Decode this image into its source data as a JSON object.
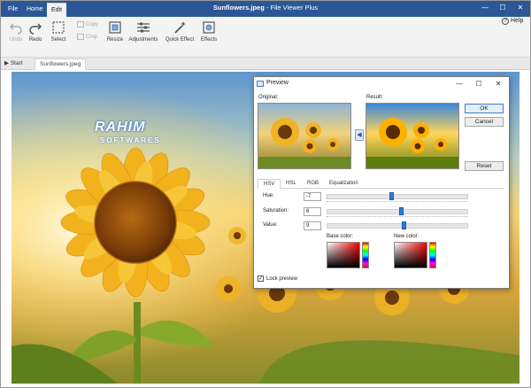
{
  "window": {
    "file_name": "Sunflowers.jpeg",
    "separator": " - ",
    "app_name": "File Viewer Plus",
    "minimize": "—",
    "maximize": "☐",
    "close": "✕"
  },
  "menu": {
    "tabs": [
      {
        "label": "File"
      },
      {
        "label": "Home"
      },
      {
        "label": "Edit",
        "active": true
      }
    ],
    "help_label": "Help"
  },
  "ribbon": {
    "undo": "Undo",
    "redo": "Redo",
    "select": "Select",
    "copy": "Copy",
    "crop": "Crop",
    "resize": "Resize",
    "adjustments": "Adjustments",
    "quick_effect": "Quick Effect",
    "effects": "Effects"
  },
  "tabstrip": {
    "start_label": "Start",
    "file_tab_label": "Sunflowers.jpeg"
  },
  "watermark": {
    "title": "RAHIM",
    "subtitle": "SOFTWARES"
  },
  "dialog": {
    "title": "Preview",
    "minimize": "—",
    "maximize": "☐",
    "close": "✕",
    "original_label": "Original:",
    "result_label": "Result:",
    "ok_label": "OK",
    "cancel_label": "Cancel",
    "reset_label": "Reset",
    "tabs": [
      {
        "label": "HSV",
        "active": true
      },
      {
        "label": "HSL"
      },
      {
        "label": "RGB"
      },
      {
        "label": "Equalization"
      }
    ],
    "hue_label": "Hue:",
    "hue_value": "-7",
    "hue_level": 0.46,
    "saturation_label": "Saturation:",
    "saturation_value": "6",
    "saturation_level": 0.53,
    "value_label": "Value:",
    "value_value": "9",
    "value_level": 0.55,
    "base_color_label": "Base color:",
    "new_color_label": "New color:",
    "lock_preview_label": "Lock preview",
    "lock_preview_checked": true
  },
  "colors": {
    "titlebar": "#2b5797",
    "accent": "#2f7bd6"
  }
}
